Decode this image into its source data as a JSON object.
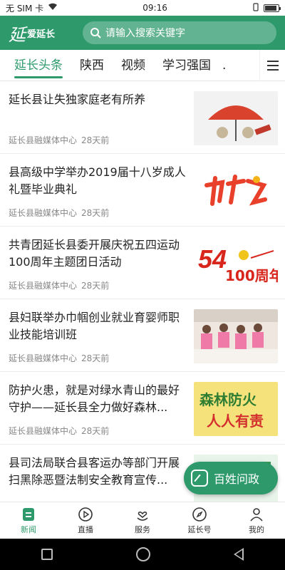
{
  "status": {
    "carrier": "无 SIM 卡",
    "time": "09:16",
    "battery_level": 0.9
  },
  "header": {
    "logo_mark": "延",
    "logo_text": "爱延长",
    "search_placeholder": "请输入搜索关键字"
  },
  "tabs": [
    {
      "label": "延长头条",
      "active": true
    },
    {
      "label": "陕西"
    },
    {
      "label": "视频"
    },
    {
      "label": "学习强国"
    },
    {
      "label": "."
    }
  ],
  "feed": [
    {
      "title": "延长县让失独家庭老有所养",
      "source": "延长县融媒体中心",
      "time": "28天前",
      "thumb": "umbrella-illustration"
    },
    {
      "title": "县高级中学举办2019届十八岁成人礼暨毕业典礼",
      "source": "延长县融媒体中心",
      "time": "28天前",
      "thumb": "coming-of-age-calligraphy"
    },
    {
      "title": "共青团延长县委开展庆祝五四运动100周年主题团日活动",
      "source": "延长县融媒体中心",
      "time": "28天前",
      "thumb": "may-fourth-100-logo",
      "thumb_text": "54",
      "thumb_text2": "100周年"
    },
    {
      "title": "县妇联举办巾帼创业就业育婴师职业技能培训班",
      "source": "延长县融媒体中心",
      "time": "28天前",
      "thumb": "training-class-photo"
    },
    {
      "title": "防护火患，就是对绿水青山的最好守护——延长县全力做好森林...",
      "source": "延长县融媒体中心",
      "time": "28天前",
      "thumb": "forest-fire-poster",
      "thumb_text": "森林防火",
      "thumb_text2": "人人有责"
    },
    {
      "title": "县司法局联合县客运办等部门开展扫黑除恶暨法制安全教育宣传...",
      "source": "",
      "time": "",
      "thumb": "green-banner"
    }
  ],
  "fab": {
    "label": "百姓问政"
  },
  "bottom_nav": [
    {
      "label": "新闻",
      "icon": "news-icon",
      "active": true
    },
    {
      "label": "直播",
      "icon": "play-icon"
    },
    {
      "label": "服务",
      "icon": "heart-hand-icon"
    },
    {
      "label": "延长号",
      "icon": "compass-icon"
    },
    {
      "label": "我的",
      "icon": "user-icon"
    }
  ],
  "colors": {
    "brand": "#2e9a6c",
    "text": "#222222",
    "meta": "#888888"
  }
}
